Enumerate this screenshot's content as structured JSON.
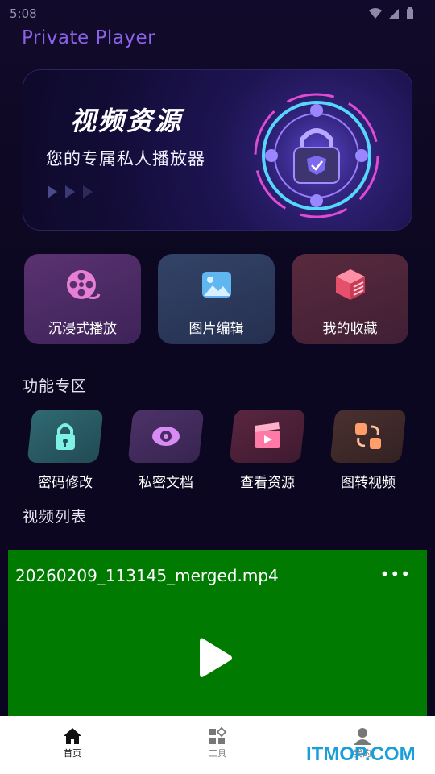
{
  "status_bar": {
    "time": "5:08"
  },
  "app": {
    "title": "Private Player"
  },
  "banner": {
    "title": "视频资源",
    "subtitle": "您的专属私人播放器"
  },
  "quick_actions": [
    {
      "label": "沉浸式播放",
      "icon": "film-reel-icon"
    },
    {
      "label": "图片编辑",
      "icon": "image-icon"
    },
    {
      "label": "我的收藏",
      "icon": "stack-box-icon"
    }
  ],
  "features": {
    "title": "功能专区",
    "items": [
      {
        "label": "密码修改",
        "icon": "lock-icon"
      },
      {
        "label": "私密文档",
        "icon": "eye-icon"
      },
      {
        "label": "查看资源",
        "icon": "clapper-icon"
      },
      {
        "label": "图转视频",
        "icon": "convert-icon"
      }
    ]
  },
  "video_list": {
    "title": "视频列表",
    "items": [
      {
        "name": "20260209_113145_merged.mp4",
        "more": "•••"
      }
    ]
  },
  "bottom_nav": [
    {
      "label": "首页",
      "icon": "home-icon",
      "active": true
    },
    {
      "label": "工具",
      "icon": "grid-icon",
      "active": false
    },
    {
      "label": "我的",
      "icon": "user-icon",
      "active": false
    }
  ],
  "watermark": "ITMOP.COM",
  "colors": {
    "accent": "#8a63e8",
    "video_bg": "#007a00",
    "nav_bg": "#ffffff"
  }
}
